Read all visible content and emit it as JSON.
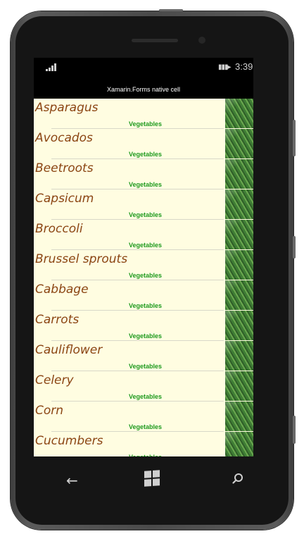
{
  "statusbar": {
    "signal_icon": "signal-bars-icon",
    "battery_icon": "battery-charging-icon",
    "time": "3:39"
  },
  "app": {
    "title": "Xamarin.Forms native cell"
  },
  "list": {
    "items": [
      {
        "name": "Asparagus",
        "category": "Vegetables",
        "image": "vegetable-thumbnail"
      },
      {
        "name": "Avocados",
        "category": "Vegetables",
        "image": "vegetable-thumbnail"
      },
      {
        "name": "Beetroots",
        "category": "Vegetables",
        "image": "vegetable-thumbnail"
      },
      {
        "name": "Capsicum",
        "category": "Vegetables",
        "image": "vegetable-thumbnail"
      },
      {
        "name": "Broccoli",
        "category": "Vegetables",
        "image": "vegetable-thumbnail"
      },
      {
        "name": "Brussel sprouts",
        "category": "Vegetables",
        "image": "vegetable-thumbnail"
      },
      {
        "name": "Cabbage",
        "category": "Vegetables",
        "image": "vegetable-thumbnail"
      },
      {
        "name": "Carrots",
        "category": "Vegetables",
        "image": "vegetable-thumbnail"
      },
      {
        "name": "Cauliflower",
        "category": "Vegetables",
        "image": "vegetable-thumbnail"
      },
      {
        "name": "Celery",
        "category": "Vegetables",
        "image": "vegetable-thumbnail"
      },
      {
        "name": "Corn",
        "category": "Vegetables",
        "image": "vegetable-thumbnail"
      },
      {
        "name": "Cucumbers",
        "category": "Vegetables",
        "image": "vegetable-thumbnail"
      }
    ]
  },
  "navbar": {
    "back_icon": "back-arrow-icon",
    "windows_icon": "windows-start-icon",
    "search_icon": "search-icon"
  },
  "colors": {
    "list_background": "#fffde1",
    "item_name": "#8b4513",
    "item_category": "#1e9a1e",
    "screen_background": "#000000"
  }
}
